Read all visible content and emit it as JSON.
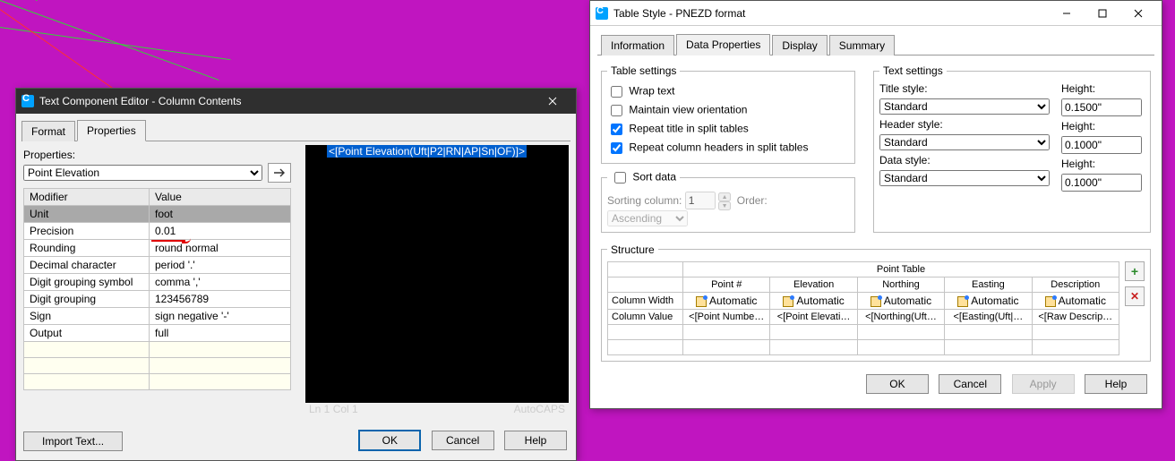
{
  "tce": {
    "title": "Text Component Editor - Column Contents",
    "tabs": {
      "format": "Format",
      "properties": "Properties"
    },
    "properties_label": "Properties:",
    "property_select": "Point Elevation",
    "headers": {
      "modifier": "Modifier",
      "value": "Value"
    },
    "rows": [
      {
        "mod": "Unit",
        "val": "foot",
        "sel": true
      },
      {
        "mod": "Precision",
        "val": "0.01"
      },
      {
        "mod": "Rounding",
        "val": "round normal"
      },
      {
        "mod": "Decimal character",
        "val": "period '.'"
      },
      {
        "mod": "Digit grouping symbol",
        "val": "comma ','"
      },
      {
        "mod": "Digit grouping",
        "val": "123456789"
      },
      {
        "mod": "Sign",
        "val": "sign negative '-'"
      },
      {
        "mod": "Output",
        "val": "full"
      }
    ],
    "code": "<[Point Elevation(Uft|P2|RN|AP|Sn|OF)]>",
    "status_left": "Ln 1 Col 1",
    "status_right": "AutoCAPS",
    "import": "Import Text...",
    "ok": "OK",
    "cancel": "Cancel",
    "help": "Help"
  },
  "ts": {
    "title": "Table Style - PNEZD format",
    "tabs": {
      "information": "Information",
      "data": "Data Properties",
      "display": "Display",
      "summary": "Summary"
    },
    "table_settings_legend": "Table settings",
    "wrap": "Wrap text",
    "maintain": "Maintain view orientation",
    "repeat_title": "Repeat title in split tables",
    "repeat_headers": "Repeat column headers in split tables",
    "sort_data": "Sort data",
    "sorting_column": "Sorting column:",
    "sort_value": "1",
    "order_label": "Order:",
    "order_value": "Ascending",
    "text_settings_legend": "Text settings",
    "title_style_label": "Title style:",
    "title_style": "Standard",
    "title_height_label": "Height:",
    "title_height": "0.1500\"",
    "header_style_label": "Header style:",
    "header_style": "Standard",
    "header_height_label": "Height:",
    "header_height": "0.1000\"",
    "data_style_label": "Data style:",
    "data_style": "Standard",
    "data_height_label": "Height:",
    "data_height": "0.1000\"",
    "structure_legend": "Structure",
    "structure": {
      "super": "Point Table",
      "cols": [
        "Point #",
        "Elevation",
        "Northing",
        "Easting",
        "Description"
      ],
      "row_width_label": "Column Width",
      "row_value_label": "Column Value",
      "auto": "Automatic",
      "vals": [
        "<[Point Numbe…",
        "<[Point Elevati…",
        "<[Northing(Uft…",
        "<[Easting(Uft|…",
        "<[Raw Descrip…"
      ]
    },
    "ok": "OK",
    "cancel": "Cancel",
    "apply": "Apply",
    "help": "Help"
  }
}
